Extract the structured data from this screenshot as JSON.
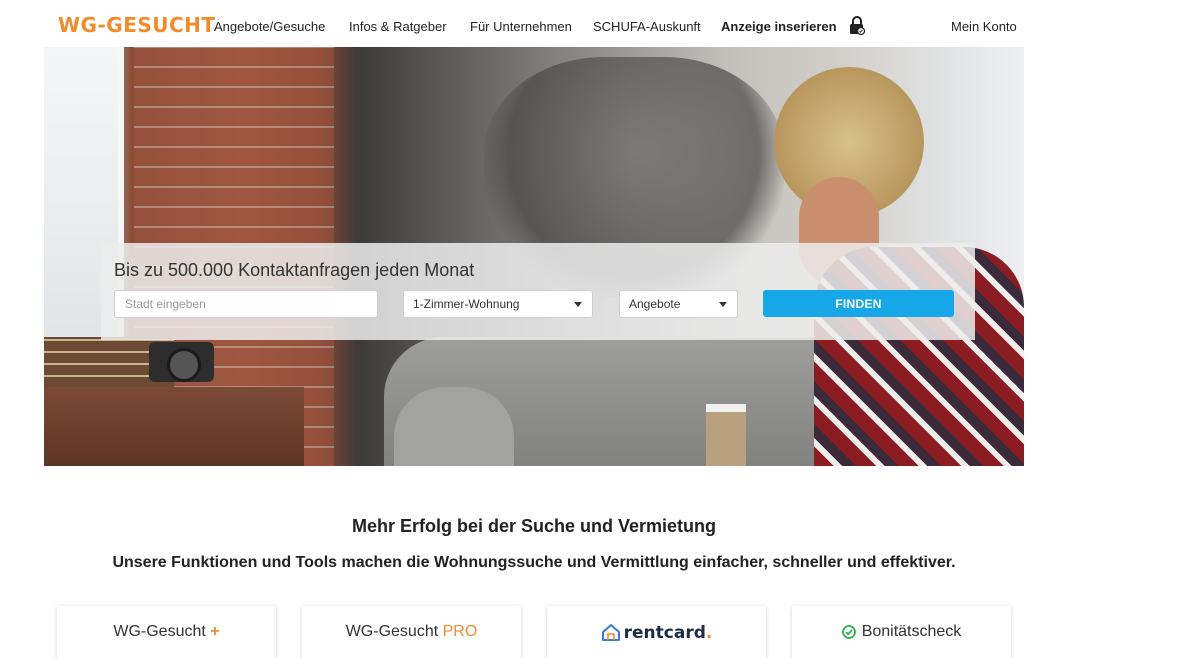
{
  "header": {
    "logo": "WG-GESUCHT",
    "nav": [
      {
        "label": "Angebote/Gesuche"
      },
      {
        "label": "Infos & Ratgeber"
      },
      {
        "label": "Für Unternehmen"
      },
      {
        "label": "SCHUFA-Auskunft"
      },
      {
        "label": "Anzeige inserieren"
      }
    ],
    "account_label": "Mein Konto",
    "lock_icon": "lock-icon"
  },
  "search": {
    "title": "Bis zu 500.000 Kontaktanfragen jeden Monat",
    "city_placeholder": "Stadt eingeben",
    "type_selected": "1-Zimmer-Wohnung",
    "category_selected": "Angebote",
    "find_label": "FINDEN"
  },
  "features": {
    "title": "Mehr Erfolg bei der Suche und Vermietung",
    "subtitle": "Unsere Funktionen und Tools machen die Wohnungssuche und Vermittlung einfacher, schneller und effektiver.",
    "cards": [
      {
        "title": "WG-Gesucht",
        "accent": "+"
      },
      {
        "title": "WG-Gesucht",
        "accent": "PRO"
      },
      {
        "title": "rentcard",
        "accent": "."
      },
      {
        "title": "Bonitätscheck"
      }
    ]
  },
  "colors": {
    "brand_orange": "#f28c28",
    "button_blue": "#16a7e9",
    "check_green": "#2bb24c",
    "rentcard_navy": "#1f2a4a"
  }
}
